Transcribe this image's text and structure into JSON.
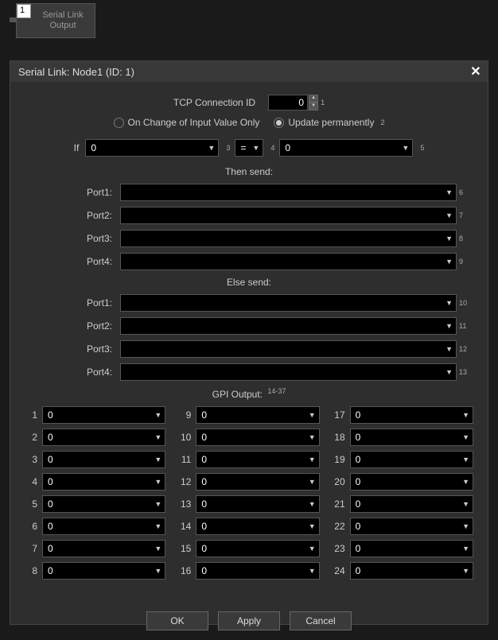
{
  "node": {
    "num": "1",
    "label": "Serial Link\nOutput"
  },
  "title": "Serial Link: Node1 (ID: 1)",
  "tcp": {
    "label": "TCP Connection ID",
    "value": "0",
    "ref": "1"
  },
  "mode": {
    "opt1": "On Change of Input Value Only",
    "opt2": "Update permanently",
    "ref": "2",
    "selected": 1
  },
  "condition": {
    "if_label": "If",
    "left": "0",
    "left_ref": "3",
    "op": "=",
    "op_ref": "4",
    "right": "0",
    "right_ref": "5"
  },
  "then_label": "Then send:",
  "else_label": "Else send:",
  "then_ports": [
    {
      "label": "Port1:",
      "value": "",
      "ref": "6"
    },
    {
      "label": "Port2:",
      "value": "",
      "ref": "7"
    },
    {
      "label": "Port3:",
      "value": "",
      "ref": "8"
    },
    {
      "label": "Port4:",
      "value": "",
      "ref": "9"
    }
  ],
  "else_ports": [
    {
      "label": "Port1:",
      "value": "",
      "ref": "10"
    },
    {
      "label": "Port2:",
      "value": "",
      "ref": "11"
    },
    {
      "label": "Port3:",
      "value": "",
      "ref": "12"
    },
    {
      "label": "Port4:",
      "value": "",
      "ref": "13"
    }
  ],
  "gpi_label": "GPI Output:",
  "gpi_ref": "14-37",
  "gpi": [
    {
      "n": "1",
      "v": "0"
    },
    {
      "n": "2",
      "v": "0"
    },
    {
      "n": "3",
      "v": "0"
    },
    {
      "n": "4",
      "v": "0"
    },
    {
      "n": "5",
      "v": "0"
    },
    {
      "n": "6",
      "v": "0"
    },
    {
      "n": "7",
      "v": "0"
    },
    {
      "n": "8",
      "v": "0"
    },
    {
      "n": "9",
      "v": "0"
    },
    {
      "n": "10",
      "v": "0"
    },
    {
      "n": "11",
      "v": "0"
    },
    {
      "n": "12",
      "v": "0"
    },
    {
      "n": "13",
      "v": "0"
    },
    {
      "n": "14",
      "v": "0"
    },
    {
      "n": "15",
      "v": "0"
    },
    {
      "n": "16",
      "v": "0"
    },
    {
      "n": "17",
      "v": "0"
    },
    {
      "n": "18",
      "v": "0"
    },
    {
      "n": "19",
      "v": "0"
    },
    {
      "n": "20",
      "v": "0"
    },
    {
      "n": "21",
      "v": "0"
    },
    {
      "n": "22",
      "v": "0"
    },
    {
      "n": "23",
      "v": "0"
    },
    {
      "n": "24",
      "v": "0"
    }
  ],
  "buttons": {
    "ok": "OK",
    "apply": "Apply",
    "cancel": "Cancel"
  }
}
